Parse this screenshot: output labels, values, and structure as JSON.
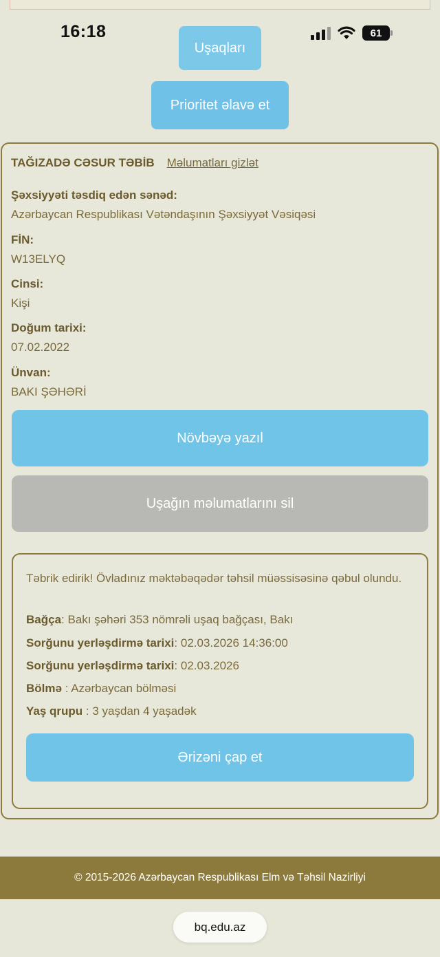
{
  "status_bar": {
    "time": "16:18",
    "battery": "61"
  },
  "nav": {
    "children_button": "Uşaqları",
    "add_priority_button": "Prioritet əlavə et"
  },
  "child": {
    "name": "TAĞIZADƏ CƏSUR TƏBİB",
    "hide_link": "Məlumatları gizlət",
    "fields": [
      {
        "label": "Şəxsiyyəti təsdiq edən sənəd:",
        "value": "Azərbaycan Respublikası Vətəndaşının Şəxsiyyət Vəsiqəsi"
      },
      {
        "label": "FİN:",
        "value": "W13ELYQ"
      },
      {
        "label": "Cinsi:",
        "value": "Kişi"
      },
      {
        "label": "Doğum tarixi:",
        "value": "07.02.2022"
      },
      {
        "label": "Ünvan:",
        "value": "BAKI ŞƏHƏRİ"
      }
    ],
    "queue_button": "Növbəyə yazıl",
    "delete_button": "Uşağın məlumatlarını sil"
  },
  "admission": {
    "congrats": "Təbrik edirik! Övladınız məktəbəqədər təhsil müəssisəsinə qəbul olundu.",
    "rows": [
      {
        "label": "Bağça",
        "sep": ": ",
        "value": "Bakı şəhəri 353 nömrəli uşaq bağçası, Bakı"
      },
      {
        "label": "Sorğunu yerləşdirmə tarixi",
        "sep": ": ",
        "value": "02.03.2026 14:36:00"
      },
      {
        "label": "Sorğunu yerləşdirmə tarixi",
        "sep": ": ",
        "value": "02.03.2026"
      },
      {
        "label": "Bölmə",
        "sep": " : ",
        "value": "Azərbaycan bölməsi"
      },
      {
        "label": "Yaş qrupu",
        "sep": " : ",
        "value": "3 yaşdan 4 yaşadək"
      }
    ],
    "print_button": "Ərizəni çap et"
  },
  "footer": {
    "copyright": "© 2015-2026 Azərbaycan Respublikası Elm və Təhsil Nazirliyi"
  },
  "browser": {
    "url": "bq.edu.az"
  },
  "colors": {
    "accent_blue": "#6fc4e8",
    "brand_olive": "#8c7a3c",
    "background": "#e6e7d9",
    "disabled_gray": "#b8b8b5"
  }
}
